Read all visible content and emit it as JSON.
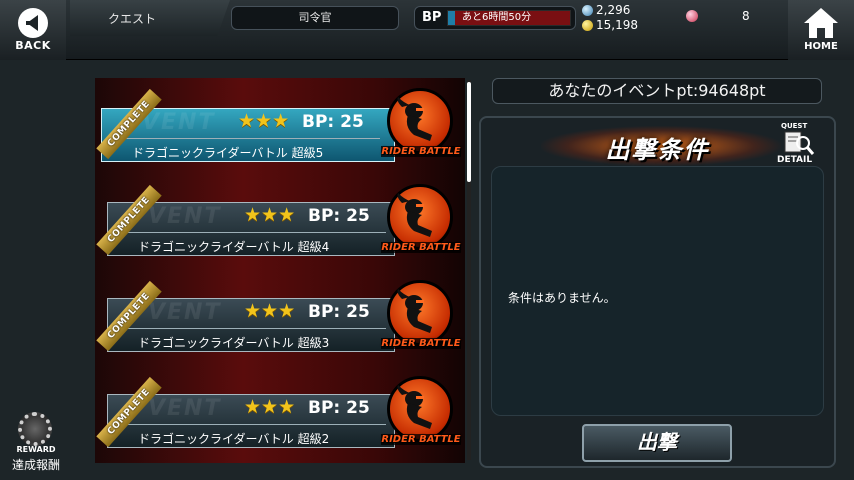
{
  "header": {
    "back_label": "BACK",
    "quest_label": "クエスト",
    "rank_label": "司令官",
    "bp_label": "BP",
    "bp_time": "あと6時間50分",
    "bp_fill_fraction": 0.06,
    "silver": "2,296",
    "gold": "15,198",
    "gem_count": "8",
    "home_label": "HOME"
  },
  "quest_list": {
    "items": [
      {
        "stars": "★★★",
        "bp_cost": "BP: 25",
        "name": "ドラゴニックライダーバトル 超級5",
        "complete": "COMPLETE",
        "badge": "RIDER BATTLE",
        "ghost": "VENT",
        "selected": true
      },
      {
        "stars": "★★★",
        "bp_cost": "BP: 25",
        "name": "ドラゴニックライダーバトル 超級4",
        "complete": "COMPLETE",
        "badge": "RIDER BATTLE",
        "ghost": "VENT",
        "selected": false
      },
      {
        "stars": "★★★",
        "bp_cost": "BP: 25",
        "name": "ドラゴニックライダーバトル 超級3",
        "complete": "COMPLETE",
        "badge": "RIDER BATTLE",
        "ghost": "VENT",
        "selected": false
      },
      {
        "stars": "★★★",
        "bp_cost": "BP: 25",
        "name": "ドラゴニックライダーバトル 超級2",
        "complete": "COMPLETE",
        "badge": "RIDER BATTLE",
        "ghost": "VENT",
        "selected": false
      }
    ]
  },
  "event_points": "あなたのイベントpt:94648pt",
  "conditions": {
    "title": "出撃条件",
    "detail_quest": "QUEST",
    "detail_label": "DETAIL",
    "text": "条件はありません。",
    "sortie_label": "出撃"
  },
  "reward": {
    "label_en": "REWARD",
    "label_jp": "達成報酬"
  },
  "colors": {
    "selected_card": "#1f8fb0",
    "card": "#243440",
    "badge": "#e0410a",
    "stars": "#f2c41b"
  }
}
